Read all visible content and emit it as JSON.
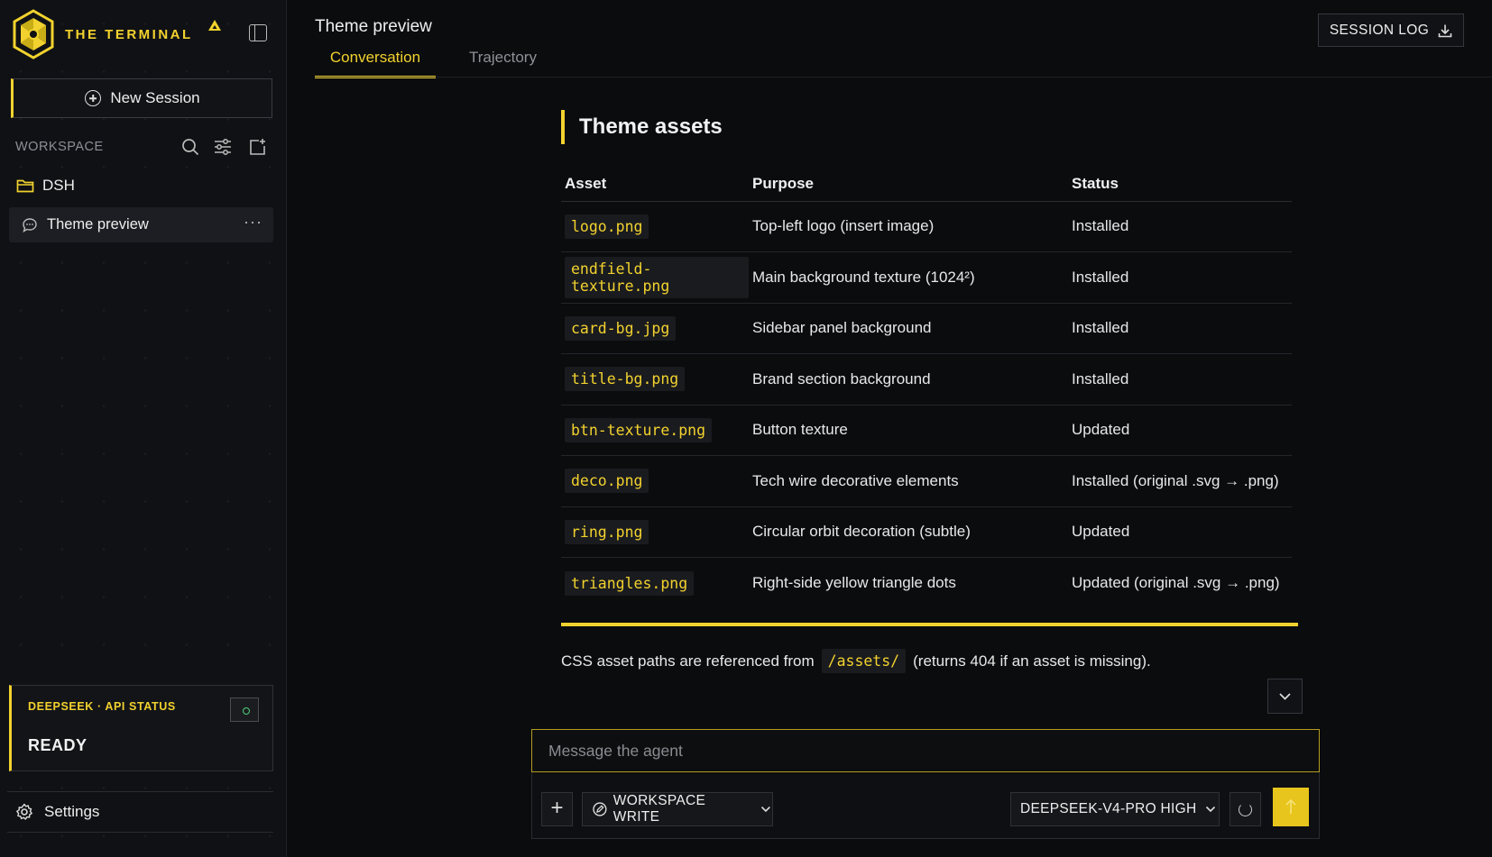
{
  "brand": {
    "name": "THE TERMINAL",
    "accent": "#f2d22e"
  },
  "sidebar": {
    "new_session": "New Session",
    "workspace_label": "WORKSPACE",
    "folder": "DSH",
    "session": "Theme preview",
    "session_menu": "···",
    "api": {
      "label": "DEEPSEEK · API STATUS",
      "status": "READY",
      "indicator_color": "#4ed07a"
    },
    "settings": "Settings"
  },
  "header": {
    "title": "Theme preview",
    "tabs": [
      {
        "label": "Conversation",
        "active": true
      },
      {
        "label": "Trajectory",
        "active": false
      }
    ],
    "session_log": "SESSION LOG"
  },
  "content": {
    "heading": "Theme assets",
    "table": {
      "headers": [
        "Asset",
        "Purpose",
        "Status"
      ],
      "rows": [
        [
          "logo.png",
          "Top-left logo (insert image)",
          "Installed"
        ],
        [
          "endfield-texture.png",
          "Main background texture (1024²)",
          "Installed"
        ],
        [
          "card-bg.jpg",
          "Sidebar panel background",
          "Installed"
        ],
        [
          "title-bg.png",
          "Brand section background",
          "Installed"
        ],
        [
          "btn-texture.png",
          "Button texture",
          "Updated"
        ],
        [
          "deco.png",
          "Tech wire decorative elements",
          "Installed (original .svg → .png)"
        ],
        [
          "ring.png",
          "Circular orbit decoration (subtle)",
          "Updated"
        ],
        [
          "triangles.png",
          "Right-side yellow triangle dots",
          "Updated (original .svg → .png)"
        ]
      ]
    },
    "footnote": {
      "before": "CSS asset paths are referenced from",
      "code": "/assets/",
      "after": "(returns 404 if an asset is missing)."
    }
  },
  "composer": {
    "placeholder": "Message the agent",
    "add_label": "+",
    "mode": "WORKSPACE WRITE",
    "model": "DEEPSEEK-V4-PRO HIGH"
  }
}
